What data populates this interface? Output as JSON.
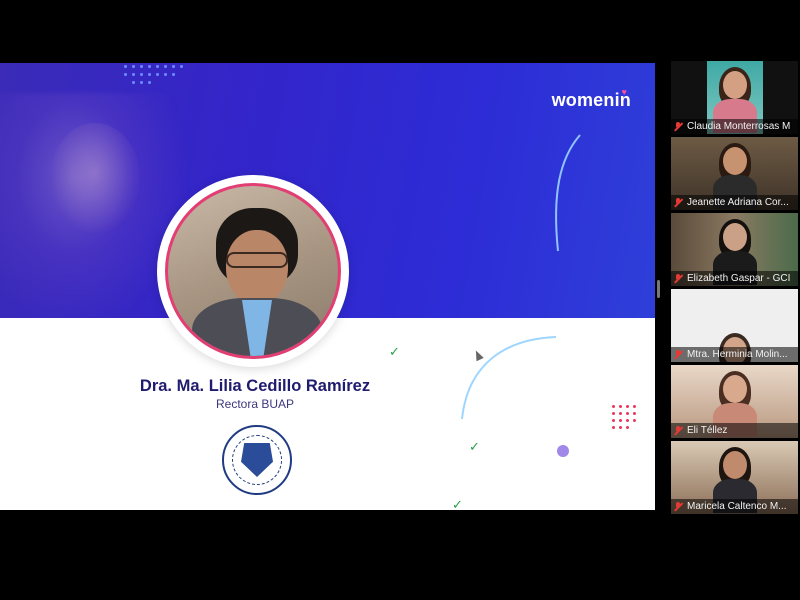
{
  "slide": {
    "brand_text": "women",
    "brand_suffix": "in",
    "speaker_name": "Dra. Ma. Lilia Cedillo Ramírez",
    "speaker_role": "Rectora BUAP",
    "brand_accent_color": "#e23e74",
    "header_color": "#3325c9"
  },
  "participants": [
    {
      "name": "Claudia Monterrosas M",
      "muted": true,
      "icon": "mic-off-icon"
    },
    {
      "name": "Jeanette Adriana Cor...",
      "muted": true,
      "icon": "mic-off-icon"
    },
    {
      "name": "Elizabeth Gaspar - GCI",
      "muted": true,
      "icon": "mic-off-icon"
    },
    {
      "name": "Mtra. Herminia Molin...",
      "muted": true,
      "icon": "mic-off-icon"
    },
    {
      "name": "Eli Téllez",
      "muted": true,
      "icon": "mic-off-icon"
    },
    {
      "name": "Maricela Caltenco M...",
      "muted": true,
      "icon": "mic-off-icon"
    }
  ]
}
